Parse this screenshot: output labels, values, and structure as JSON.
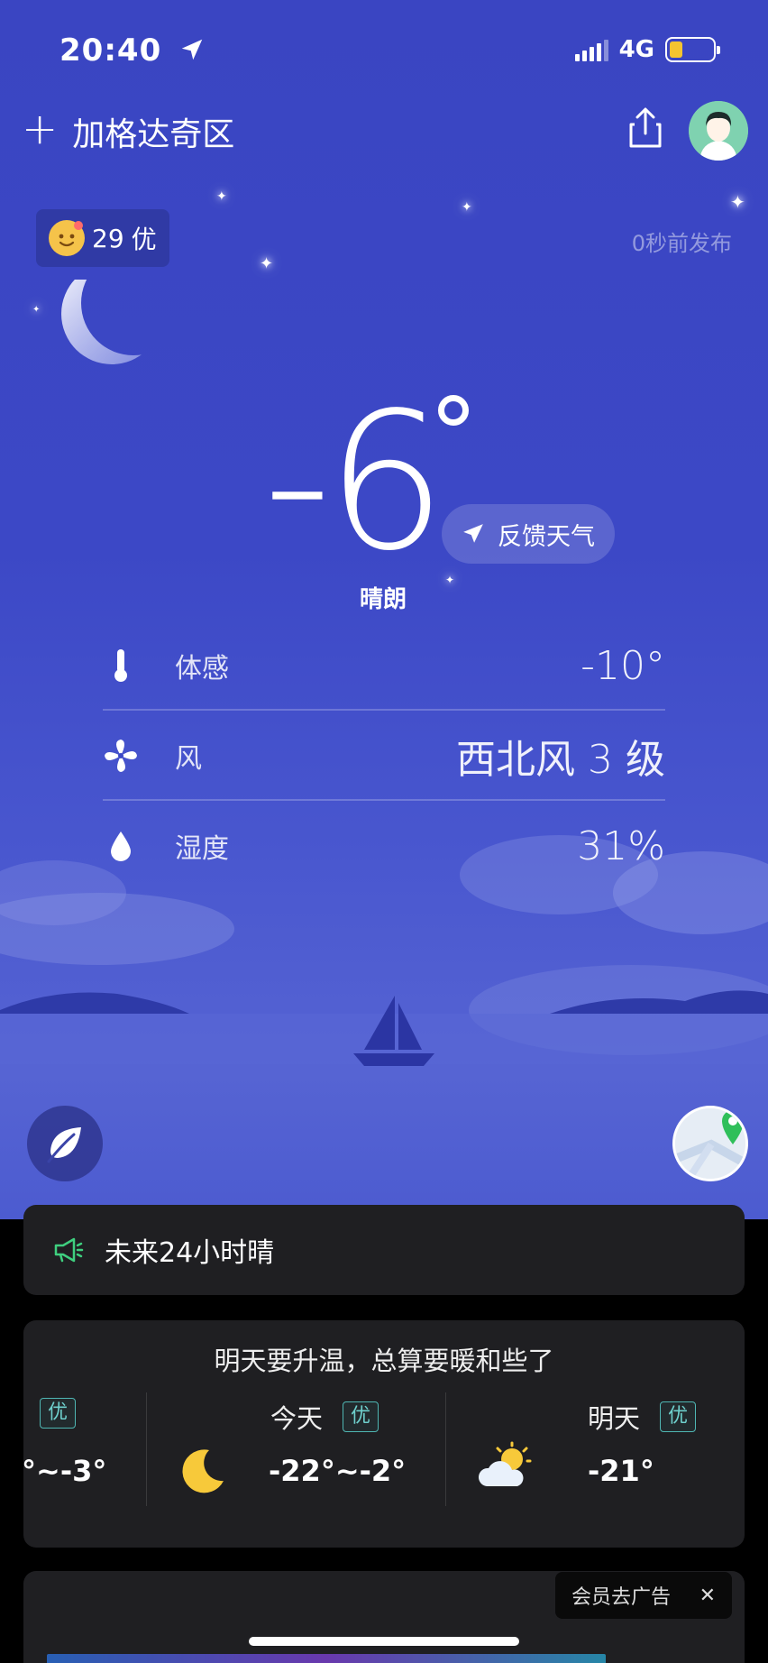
{
  "status_bar": {
    "time": "20:40",
    "network": "4G"
  },
  "header": {
    "location": "加格达奇区"
  },
  "aqi": {
    "value": "29",
    "level": "优"
  },
  "publish_time": "0秒前发布",
  "current": {
    "temperature": "-6",
    "condition": "晴朗",
    "feedback_label": "反馈天气"
  },
  "details": [
    {
      "icon": "thermometer-icon",
      "label": "体感",
      "value": "-10°"
    },
    {
      "icon": "fan-icon",
      "label": "风",
      "value": "西北风 3 级"
    },
    {
      "icon": "droplet-icon",
      "label": "湿度",
      "value": "31%"
    }
  ],
  "alert": {
    "text": "未来24小时晴"
  },
  "forecast": {
    "title": "明天要升温，总算要暖和些了",
    "days": [
      {
        "day": "",
        "badge": "优",
        "range": "°~-3°",
        "icon": ""
      },
      {
        "day": "今天",
        "badge": "优",
        "range": "-22°~-2°",
        "icon": "moon-icon"
      },
      {
        "day": "明天",
        "badge": "优",
        "range": "-21°",
        "icon": "partly-cloudy-icon"
      }
    ]
  },
  "ad": {
    "remove_label": "会员去广告",
    "close_label": "✕"
  },
  "colors": {
    "sky_top": "#3a45c2",
    "badge": "#4fb6b3",
    "card_bg": "#1f1f22",
    "alert_icon": "#3fcf7f"
  }
}
